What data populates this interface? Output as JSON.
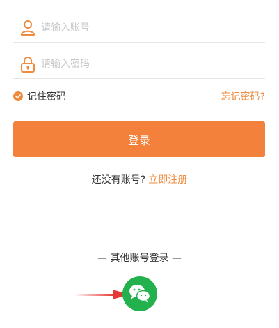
{
  "form": {
    "account_placeholder": "请输入账号",
    "password_placeholder": "请输入密码",
    "remember_label": "记住密码",
    "forgot_label": "忘记密码?",
    "login_label": "登录"
  },
  "register": {
    "prompt": "还没有账号?",
    "link": "立即注册"
  },
  "other": {
    "label": "— 其他账号登录 —"
  },
  "icons": {
    "account": "user-icon",
    "password": "lock-icon",
    "remember": "check-circle-icon",
    "wechat": "wechat-icon",
    "annotation": "red-arrow-icon"
  },
  "colors": {
    "accent": "#f3813c",
    "wechat": "#22b14c",
    "arrow": "#e53935"
  }
}
